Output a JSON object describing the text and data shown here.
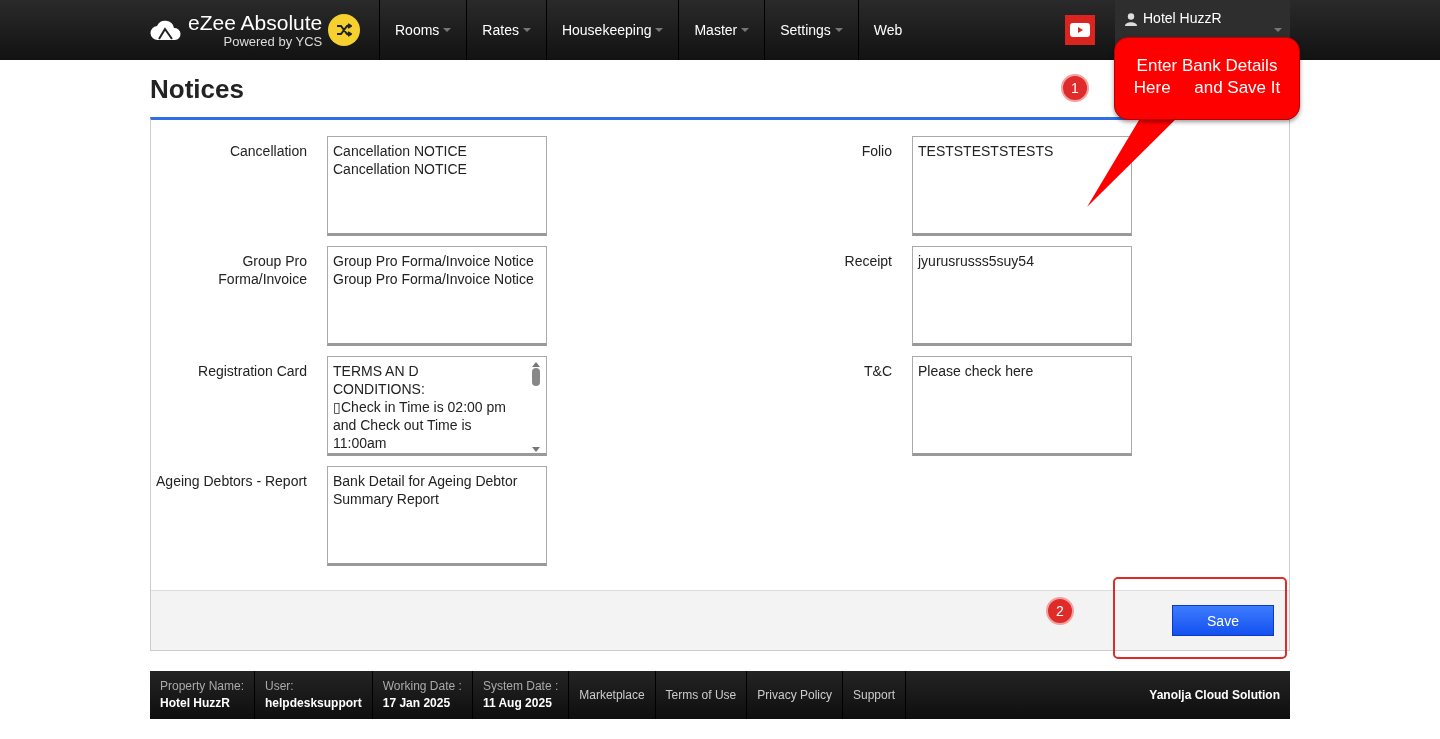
{
  "brand": {
    "name": "eZee Absolute",
    "tagline": "Powered by YCS"
  },
  "nav": [
    {
      "label": "Rooms",
      "dropdown": true
    },
    {
      "label": "Rates",
      "dropdown": true
    },
    {
      "label": "Housekeeping",
      "dropdown": true
    },
    {
      "label": "Master",
      "dropdown": true
    },
    {
      "label": "Settings",
      "dropdown": true
    },
    {
      "label": "Web",
      "dropdown": false
    }
  ],
  "user_menu": {
    "name": "Hotel HuzzR"
  },
  "page_title": "Notices",
  "left_fields": [
    {
      "label": "Cancellation",
      "value": "Cancellation NOTICE\nCancellation NOTICE",
      "scrollbar": false
    },
    {
      "label": "Group Pro Forma/Invoice",
      "value": "Group Pro Forma/Invoice Notice\nGroup Pro Forma/Invoice Notice",
      "scrollbar": false
    },
    {
      "label": "Registration Card",
      "value": "TERMS AN D\nCONDITIONS:\n▯Check in Time is 02:00 pm\nand Check out Time is\n11:00am",
      "scrollbar": true
    },
    {
      "label": "Ageing Debtors - Report",
      "value": "Bank Detail for Ageing Debtor\nSummary Report",
      "scrollbar": false
    }
  ],
  "right_fields": [
    {
      "label": "Folio",
      "value": "TESTSTESTSTESTS",
      "scrollbar": false
    },
    {
      "label": "Receipt",
      "value": "jyurusrusss5suy54",
      "scrollbar": false
    },
    {
      "label": "T&C",
      "value": "Please check here",
      "scrollbar": false
    }
  ],
  "save_button": "Save",
  "annotations": {
    "callout": "Enter Bank Details\nHere     and Save It",
    "step_1": "1",
    "step_2": "2"
  },
  "footer": {
    "info": [
      {
        "label": "Property Name:",
        "value": "Hotel HuzzR"
      },
      {
        "label": "User:",
        "value": "helpdesksupport"
      },
      {
        "label": "Working Date :",
        "value": "17 Jan 2025"
      },
      {
        "label": "System Date :",
        "value": "11 Aug 2025"
      }
    ],
    "links": [
      "Marketplace",
      "Terms of Use",
      "Privacy Policy",
      "Support"
    ],
    "company": "Yanolja Cloud Solution"
  }
}
